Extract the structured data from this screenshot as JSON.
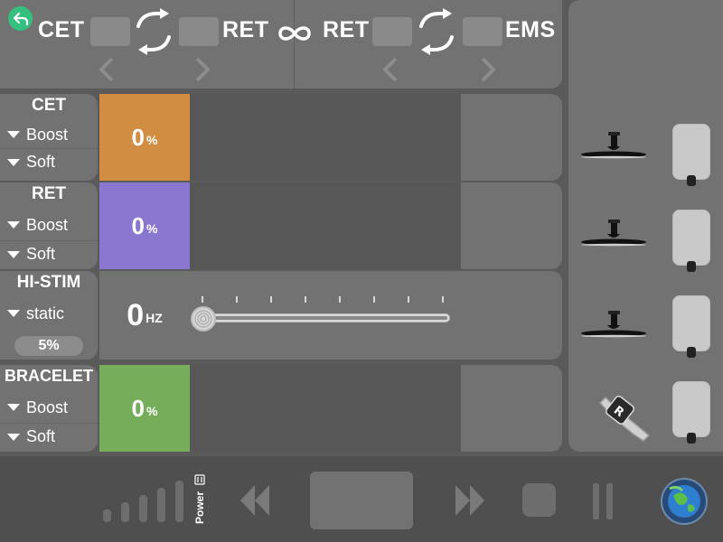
{
  "mode_bar": {
    "left_from": "CET",
    "left_to": "RET",
    "right_from": "RET",
    "right_to": "EMS"
  },
  "rows": [
    {
      "title": "CET",
      "options": [
        "Boost",
        "Soft"
      ],
      "value": "0",
      "unit": "%",
      "color": "#d18e43"
    },
    {
      "title": "RET",
      "options": [
        "Boost",
        "Soft"
      ],
      "value": "0",
      "unit": "%",
      "color": "#8a78d0"
    },
    {
      "title": "HI-STIM",
      "options": [
        "static"
      ],
      "percent": "5%",
      "value": "0",
      "unit": "HZ",
      "slider_value": 0
    },
    {
      "title": "BRACELET",
      "options": [
        "Boost",
        "Soft"
      ],
      "value": "0",
      "unit": "%",
      "color": "#76ad5b"
    }
  ],
  "bottom": {
    "power_label": "Power",
    "power_level": 0
  },
  "colors": {
    "accent_green": "#34c07e",
    "panel": "#727272",
    "track": "#575757"
  },
  "icons": [
    "back-icon",
    "swap-icon",
    "infinity-icon",
    "chevron-left-icon",
    "chevron-right-icon",
    "handpiece-icon",
    "electrode-pad-icon",
    "bracelet-icon",
    "rewind-icon",
    "fast-forward-icon",
    "stop-icon",
    "pause-icon",
    "globe-icon"
  ]
}
